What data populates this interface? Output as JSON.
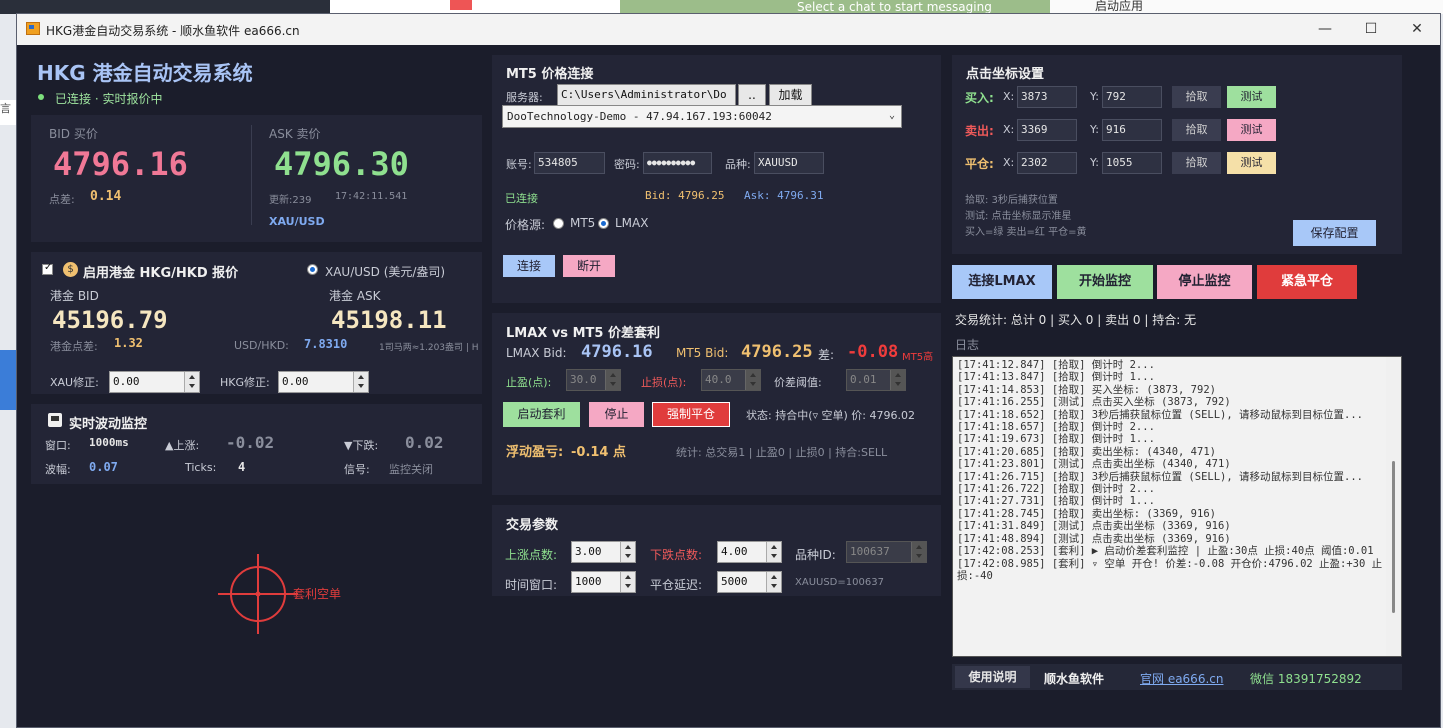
{
  "window": {
    "title": "HKG港金自动交易系统 - 顺水鱼软件 ea666.cn",
    "minimize": "—",
    "maximize": "☐",
    "close": "✕"
  },
  "background": {
    "chat_hint": "Select a chat to start messaging",
    "app_launch": "启动应用",
    "side_char": "言"
  },
  "header": {
    "title": "HKG 港金自动交易系统",
    "status": "已连接 · 实时报价中"
  },
  "quote": {
    "bid_label": "BID 买价",
    "bid": "4796.16",
    "spread_label": "点差:",
    "spread": "0.14",
    "ask_label": "ASK 卖价",
    "ask": "4796.30",
    "update_label": "更新:239",
    "time": "17:42:11.541",
    "symbol": "XAU/USD"
  },
  "hkg": {
    "enable_label": "启用港金 HKG/HKD 报价",
    "radio_label": "XAU/USD (美元/盎司)",
    "bid_label": "港金 BID",
    "bid": "45196.79",
    "ask_label": "港金 ASK",
    "ask": "45198.11",
    "spread_label": "港金点差:",
    "spread": "1.32",
    "rate_label": "USD/HKD:",
    "rate": "7.8310",
    "note": "1司马两≈1.203盎司 | H",
    "xau_fix_label": "XAU修正:",
    "xau_fix": "0.00",
    "hkg_fix_label": "HKG修正:",
    "hkg_fix": "0.00"
  },
  "monitor": {
    "title": "实时波动监控",
    "window_label": "窗口:",
    "window": "1000ms",
    "up_label": "▲上涨:",
    "up": "-0.02",
    "down_label": "▼下跌:",
    "down": "0.02",
    "amp_label": "波幅:",
    "amp": "0.07",
    "ticks_label": "Ticks:",
    "ticks": "4",
    "signal_label": "信号:",
    "signal": "监控关闭"
  },
  "target": {
    "label": "套利空单"
  },
  "mt5": {
    "title": "MT5 价格连接",
    "server_label": "服务器:",
    "path": "C:\\Users\\Administrator\\Do",
    "browse": "..",
    "load": "加载",
    "server": "DooTechnology-Demo - 47.94.167.193:60042",
    "account_label": "账号:",
    "account": "534805",
    "password_label": "密码:",
    "password": "●●●●●●●●●●",
    "symbol_label": "品种:",
    "symbol": "XAUUSD",
    "connected": "已连接",
    "bid": "Bid: 4796.25",
    "ask": "Ask: 4796.31",
    "source_label": "价格源:",
    "src_mt5": "MT5",
    "src_lmax": "LMAX",
    "connect": "连接",
    "disconnect": "断开"
  },
  "arb": {
    "title": "LMAX vs MT5 价差套利",
    "lmax_label": "LMAX Bid:",
    "lmax": "4796.16",
    "mt5_label": "MT5 Bid:",
    "mt5": "4796.25",
    "diff_label": "差:",
    "diff": "-0.08",
    "diff_extra": "MT5高",
    "tp_label": "止盈(点):",
    "tp": "30.0",
    "sl_label": "止损(点):",
    "sl": "40.0",
    "th_label": "价差阈值:",
    "th": "0.01",
    "start": "启动套利",
    "stop": "停止",
    "force": "强制平仓",
    "state": "状态: 持合中(▿ 空单) 价: 4796.02",
    "pnl_label": "浮动盈亏:",
    "pnl": "-0.14 点",
    "stats": "统计: 总交易1 | 止盈0 | 止损0 | 持合:SELL"
  },
  "params": {
    "title": "交易参数",
    "up_label": "上涨点数:",
    "up": "3.00",
    "down_label": "下跌点数:",
    "down": "4.00",
    "id_label": "品种ID:",
    "id": "100637",
    "win_label": "时间窗口:",
    "win": "1000",
    "delay_label": "平仓延迟:",
    "delay": "5000",
    "note": "XAUUSD=100637"
  },
  "coords": {
    "title": "点击坐标设置",
    "buy_label": "买入:",
    "sell_label": "卖出:",
    "close_label": "平仓:",
    "x": "X:",
    "y": "Y:",
    "buy_x": "3873",
    "buy_y": "792",
    "sell_x": "3369",
    "sell_y": "916",
    "close_x": "2302",
    "close_y": "1055",
    "pick": "拾取",
    "test": "测试",
    "help1": "拾取: 3秒后捕获位置",
    "help2": "测试: 点击坐标显示准星",
    "help3": "买入=绿 卖出=红 平仓=黄",
    "save": "保存配置"
  },
  "actions": {
    "connect_lmax": "连接LMAX",
    "start": "开始监控",
    "stop": "停止监控",
    "emergency": "紧急平仓"
  },
  "stats": "交易统计: 总计 0 | 买入 0 | 卖出 0 | 持合: 无",
  "log_label": "日志",
  "log": [
    "[17:41:12.847] [拾取] 倒计时 2...",
    "[17:41:13.847] [拾取] 倒计时 1...",
    "[17:41:14.853] [拾取] 买入坐标: (3873, 792)",
    "[17:41:16.255] [测试] 点击买入坐标 (3873, 792)",
    "[17:41:18.652] [拾取] 3秒后捕获鼠标位置 (SELL), 请移动鼠标到目标位置...",
    "[17:41:18.657] [拾取] 倒计时 2...",
    "[17:41:19.673] [拾取] 倒计时 1...",
    "[17:41:20.685] [拾取] 卖出坐标: (4340, 471)",
    "[17:41:23.801] [测试] 点击卖出坐标 (4340, 471)",
    "[17:41:26.715] [拾取] 3秒后捕获鼠标位置 (SELL), 请移动鼠标到目标位置...",
    "[17:41:26.722] [拾取] 倒计时 2...",
    "[17:41:27.731] [拾取] 倒计时 1...",
    "[17:41:28.745] [拾取] 卖出坐标: (3369, 916)",
    "[17:41:31.849] [测试] 点击卖出坐标 (3369, 916)",
    "[17:41:48.894] [测试] 点击卖出坐标 (3369, 916)",
    "[17:42:08.253] [套利] ▶ 启动价差套利监控 | 止盈:30点 止损:40点 阈值:0.01",
    "[17:42:08.985] [套利] ▿ 空单 开仓! 价差:-0.08 开仓价:4796.02 止盈:+30 止损:-40"
  ],
  "footer": {
    "help": "使用说明",
    "brand": "顺水鱼软件",
    "site": "官网 ea666.cn",
    "wechat": "微信 18391752892"
  },
  "colors": {
    "bg": "#1b1d2b",
    "panel": "#232536",
    "bid": "#f07896",
    "ask": "#8fe08f",
    "accent": "#7faaf0",
    "gold": "#f0c070"
  }
}
